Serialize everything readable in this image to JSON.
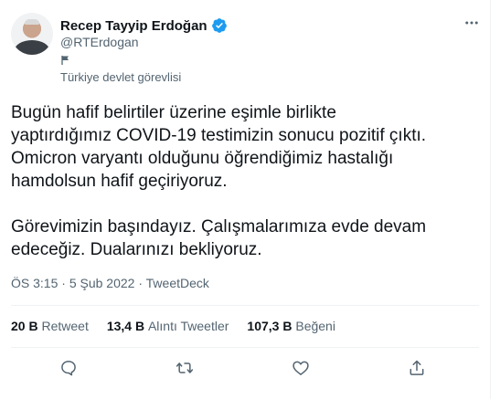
{
  "author": {
    "display_name": "Recep Tayyip Erdoğan",
    "handle": "@RTErdogan",
    "label": "Türkiye devlet görevlisi"
  },
  "tweet": {
    "text": "Bugün hafif belirtiler üzerine eşimle birlikte\nyaptırdığımız COVID-19 testimizin sonucu pozitif çıktı.\nOmicron varyantı olduğunu öğrendiğimiz hastalığı\nhamdolsun hafif geçiriyoruz.\n\nGörevimizin başındayız. Çalışmalarımıza evde devam\nedeceğiz. Dualarınızı bekliyoruz.",
    "time": "ÖS 3:15",
    "date": "5 Şub 2022",
    "source": "TweetDeck"
  },
  "stats": {
    "retweets": {
      "count": "20 B",
      "label": "Retweet"
    },
    "quotes": {
      "count": "13,4 B",
      "label": "Alıntı Tweetler"
    },
    "likes": {
      "count": "107,3 B",
      "label": "Beğeni"
    }
  },
  "icons": {
    "verified": "verified-badge-icon",
    "more": "more-dots-icon",
    "label": "flag-icon",
    "reply": "reply-icon",
    "retweet": "retweet-icon",
    "like": "like-icon",
    "share": "share-icon"
  },
  "colors": {
    "text_primary": "#0f1419",
    "text_secondary": "#536471",
    "verified_blue": "#1d9bf0",
    "divider": "#eff3f4"
  }
}
